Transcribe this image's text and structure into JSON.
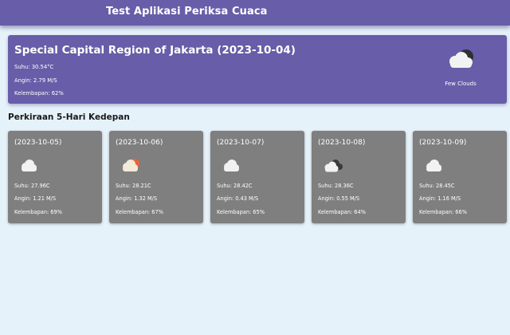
{
  "app": {
    "title": "Test Aplikasi Periksa Cuaca"
  },
  "current": {
    "title": "Special Capital Region of Jakarta (2023-10-04)",
    "temp": "Suhu: 30.54°C",
    "wind": "Angin: 2.79 M/S",
    "humidity": "Kelembapan: 62%",
    "icon": "few-clouds-icon",
    "description": "Few Clouds"
  },
  "forecast": {
    "heading": "Perkiraan 5-Hari Kedepan",
    "days": [
      {
        "date": "(2023-10-05)",
        "icon": "cloud-icon",
        "temp": "Suhu: 27.96C",
        "wind": "Angin: 1.21 M/S",
        "humidity": "Kelembapan: 69%"
      },
      {
        "date": "(2023-10-06)",
        "icon": "partly-sunny-icon",
        "temp": "Suhu: 28.21C",
        "wind": "Angin: 1.32 M/S",
        "humidity": "Kelembapan: 67%"
      },
      {
        "date": "(2023-10-07)",
        "icon": "cloud-icon",
        "temp": "Suhu: 28.42C",
        "wind": "Angin: 0.43 M/S",
        "humidity": "Kelembapan: 65%"
      },
      {
        "date": "(2023-10-08)",
        "icon": "broken-clouds-icon",
        "temp": "Suhu: 28.36C",
        "wind": "Angin: 0.55 M/S",
        "humidity": "Kelembapan: 64%"
      },
      {
        "date": "(2023-10-09)",
        "icon": "cloud-icon",
        "temp": "Suhu: 28.45C",
        "wind": "Angin: 1.16 M/S",
        "humidity": "Kelembapan: 66%"
      }
    ]
  }
}
